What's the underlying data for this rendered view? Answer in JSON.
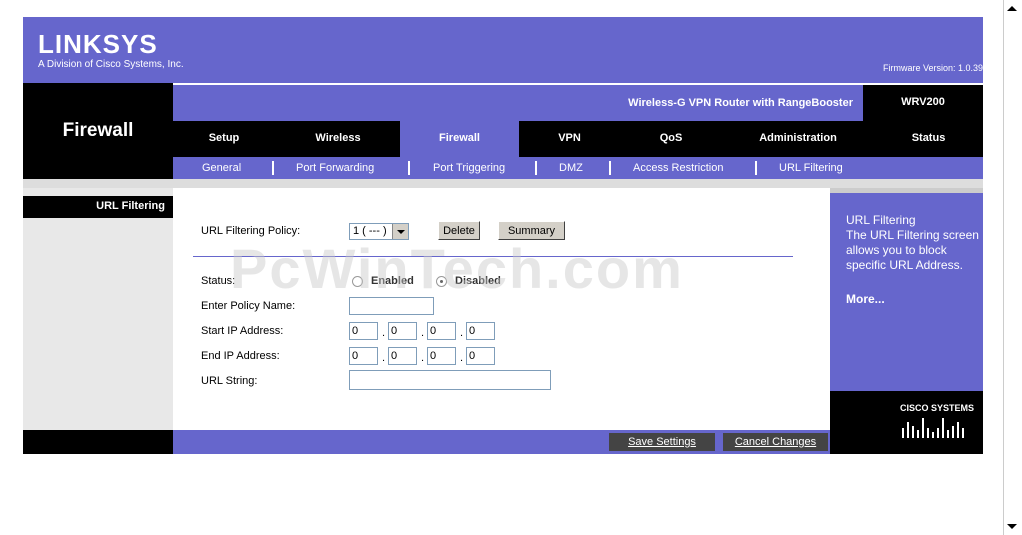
{
  "header": {
    "brand": "LINKSYS",
    "brand_sub": "A Division of Cisco Systems, Inc.",
    "firmware": "Firmware Version: 1.0.39",
    "product_name": "Wireless-G VPN Router with RangeBooster",
    "model": "WRV200",
    "section_title": "Firewall"
  },
  "tabs": [
    "Setup",
    "Wireless",
    "Firewall",
    "VPN",
    "QoS",
    "Administration",
    "Status"
  ],
  "subtabs": [
    "General",
    "Port Forwarding",
    "Port Triggering",
    "DMZ",
    "Access Restriction",
    "URL Filtering"
  ],
  "left": {
    "section_label": "URL Filtering"
  },
  "form": {
    "policy_label": "URL Filtering Policy:",
    "policy_value": "1 ( --- )",
    "delete_label": "Delete",
    "summary_label": "Summary",
    "status_label": "Status:",
    "enabled_label": "Enabled",
    "disabled_label": "Disabled",
    "status_value": "Disabled",
    "policy_name_label": "Enter Policy Name:",
    "policy_name_value": "",
    "start_ip_label": "Start IP Address:",
    "start_ip": [
      "0",
      "0",
      "0",
      "0"
    ],
    "end_ip_label": "End IP Address:",
    "end_ip": [
      "0",
      "0",
      "0",
      "0"
    ],
    "url_string_label": "URL String:",
    "url_string_value": ""
  },
  "help": {
    "title": "URL Filtering",
    "line1": "The URL Filtering screen",
    "line2": "allows you to block",
    "line3": "specific URL Address.",
    "more": "More..."
  },
  "footer": {
    "save_label": "Save Settings",
    "cancel_label": "Cancel Changes",
    "cisco_label": "CISCO SYSTEMS"
  },
  "watermark": "PcWinTech.com",
  "colors": {
    "accent": "#6666cc",
    "dark": "#000000"
  }
}
